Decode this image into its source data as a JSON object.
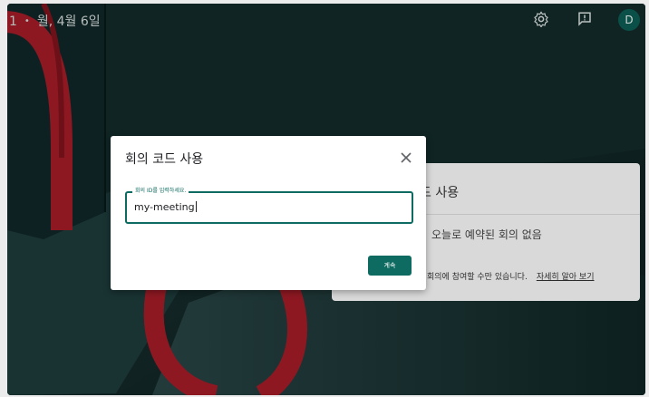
{
  "topbar": {
    "time": "1",
    "separator": "•",
    "date": "월, 4월 6일",
    "icons": [
      "settings-icon",
      "feedback-icon"
    ],
    "avatar_letter": "D"
  },
  "background_card": {
    "title_fragment": "드 사용",
    "no_meetings_text": "오늘로 예약된 회의 없음",
    "footer_text": "회의에 참여할 수만 있습니다.",
    "learn_more_link": "자세히 알아 보기"
  },
  "dialog": {
    "title": "회의 코드 사용",
    "input_label": "회의 ID를 입력하세요.",
    "input_value": "my-meeting",
    "continue_label": "계속"
  },
  "colors": {
    "accent": "#0d6b61",
    "background_dark": "#0f2323",
    "decor_red": "#a11c27"
  }
}
